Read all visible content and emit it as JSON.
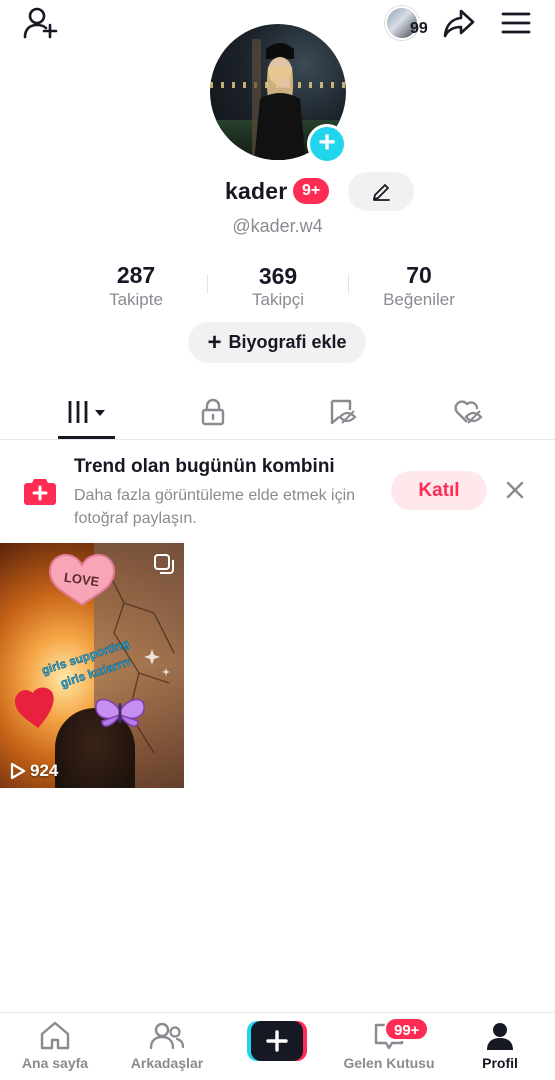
{
  "profile": {
    "display_name": "kader",
    "name_badge": "9+",
    "handle": "@kader.w4",
    "story_count": "99",
    "bio_button": "Biyografi ekle"
  },
  "stats": [
    {
      "value": "287",
      "label": "Takipte"
    },
    {
      "value": "369",
      "label": "Takipçi"
    },
    {
      "value": "70",
      "label": "Beğeniler"
    }
  ],
  "tabs": [
    {
      "icon": "videos-grid-icon",
      "active": true
    },
    {
      "icon": "lock-icon",
      "active": false
    },
    {
      "icon": "bookmark-eye-icon",
      "active": false
    },
    {
      "icon": "heart-eye-icon",
      "active": false
    }
  ],
  "trend_card": {
    "title": "Trend olan bugünün kombini",
    "description": "Daha fazla görüntüleme elde etmek için fotoğraf paylaşın.",
    "join_label": "Katıl"
  },
  "videos": [
    {
      "views": "924",
      "sticker_love": "LOVE",
      "sticker_text_1": "girls supporting",
      "sticker_text_2": "girls kızlarrrr"
    }
  ],
  "bottom_nav": {
    "items": [
      {
        "label": "Ana sayfa",
        "icon": "home-icon"
      },
      {
        "label": "Arkadaşlar",
        "icon": "friends-icon"
      },
      {
        "label": "",
        "icon": "create-plus-icon"
      },
      {
        "label": "Gelen Kutusu",
        "icon": "inbox-icon"
      },
      {
        "label": "Profil",
        "icon": "profile-icon"
      }
    ],
    "inbox_badge": "99+"
  },
  "colors": {
    "accent_red": "#fe2c55",
    "accent_cyan": "#20d5ec",
    "text_primary": "#161823",
    "text_secondary": "#8a8b91"
  }
}
